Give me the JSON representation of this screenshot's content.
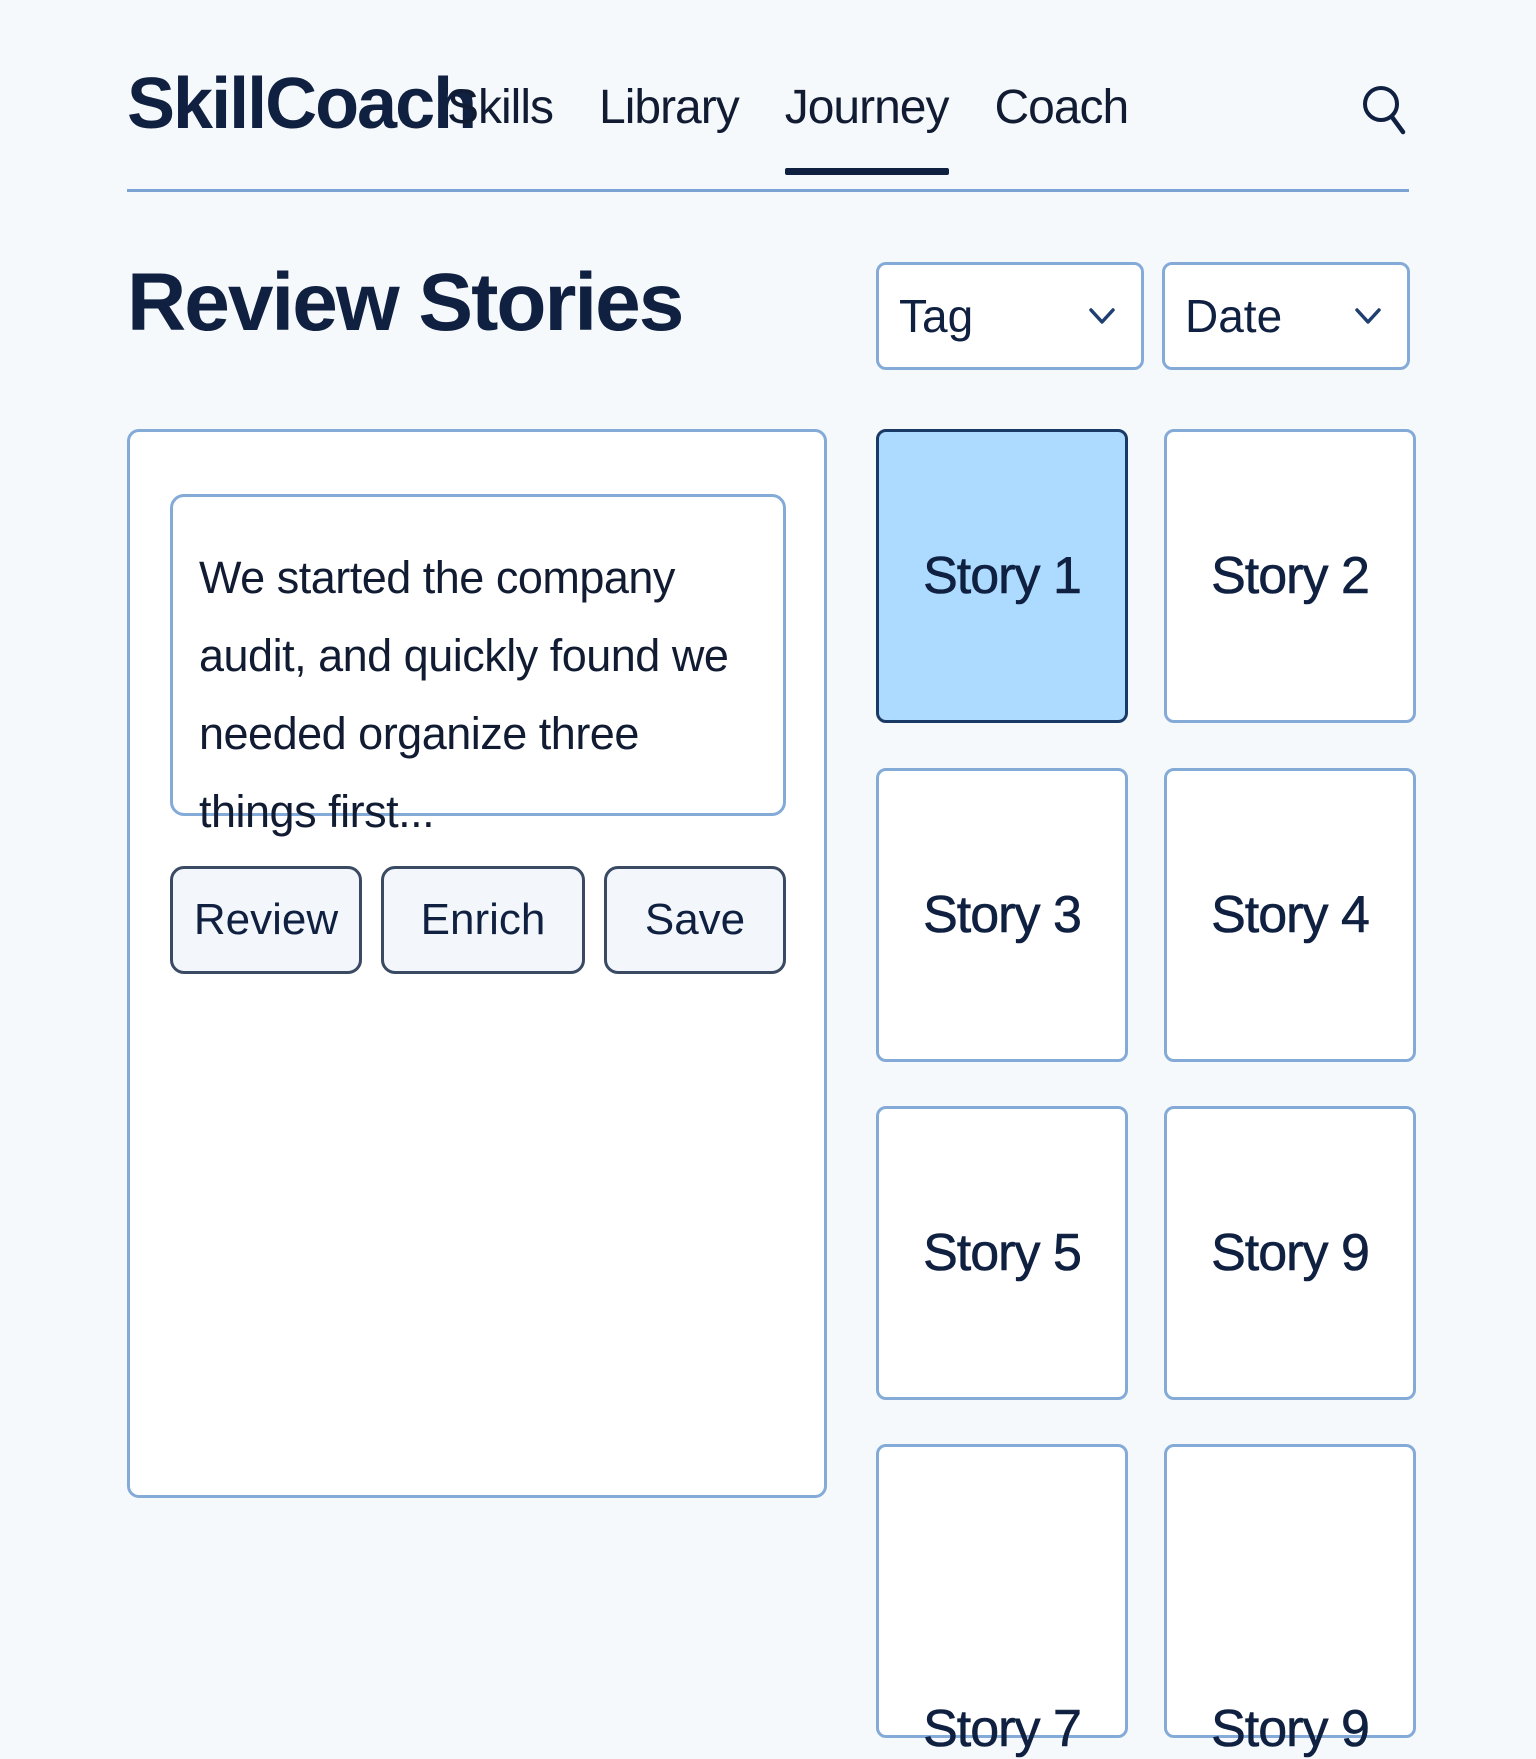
{
  "header": {
    "logo": "SkillCoach",
    "nav": [
      {
        "label": "Skills",
        "active": false
      },
      {
        "label": "Library",
        "active": false
      },
      {
        "label": "Journey",
        "active": true
      },
      {
        "label": "Coach",
        "active": false
      }
    ],
    "search_icon": "search-icon"
  },
  "page": {
    "title": "Review Stories"
  },
  "filters": {
    "tag": "Tag",
    "date": "Date",
    "icon": "chevron-down-icon"
  },
  "editor": {
    "text": "We started the company audit, and quickly found we needed organize three things first...",
    "buttons": {
      "review": "Review",
      "enrich": "Enrich",
      "save": "Save"
    }
  },
  "stories": [
    {
      "label": "Story 1",
      "selected": true
    },
    {
      "label": "Story 2",
      "selected": false
    },
    {
      "label": "Story 3",
      "selected": false
    },
    {
      "label": "Story 4",
      "selected": false
    },
    {
      "label": "Story 5",
      "selected": false
    },
    {
      "label": "Story 9",
      "selected": false
    },
    {
      "label": "Story 7",
      "selected": false
    },
    {
      "label": "Story 9",
      "selected": false
    }
  ],
  "colors": {
    "background": "#f6f9fc",
    "text": "#0f2040",
    "border": "#84abd8",
    "selected": "#addaff"
  }
}
